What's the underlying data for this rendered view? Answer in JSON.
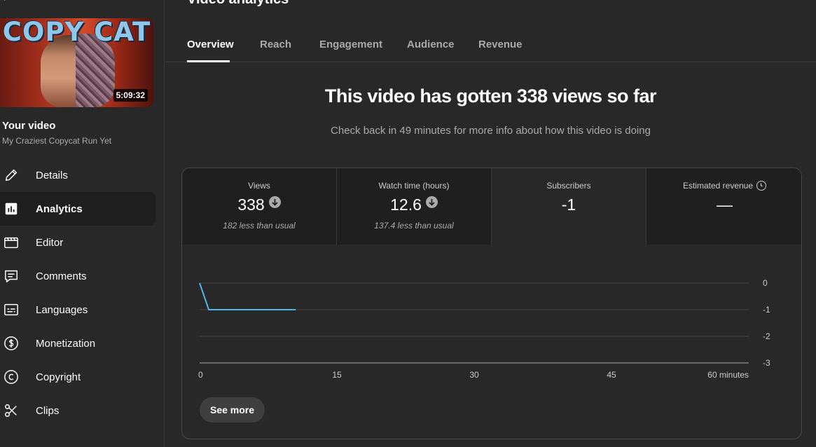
{
  "thumbnail": {
    "title_art": "COPY CAT",
    "duration": "5:09:32"
  },
  "sidebar": {
    "your_video_label": "Your video",
    "video_title": "My Craziest Copycat Run Yet",
    "items": [
      {
        "label": "Details",
        "icon": "pencil-icon"
      },
      {
        "label": "Analytics",
        "icon": "analytics-icon",
        "active": true
      },
      {
        "label": "Editor",
        "icon": "clapperboard-icon"
      },
      {
        "label": "Comments",
        "icon": "comment-icon"
      },
      {
        "label": "Languages",
        "icon": "subtitles-icon"
      },
      {
        "label": "Monetization",
        "icon": "dollar-icon"
      },
      {
        "label": "Copyright",
        "icon": "copyright-icon"
      },
      {
        "label": "Clips",
        "icon": "scissors-icon"
      }
    ]
  },
  "main": {
    "page_title": "Video analytics",
    "tabs": [
      {
        "label": "Overview",
        "active": true
      },
      {
        "label": "Reach"
      },
      {
        "label": "Engagement"
      },
      {
        "label": "Audience"
      },
      {
        "label": "Revenue"
      }
    ],
    "headline": "This video has gotten 338 views so far",
    "subline": "Check back in 49 minutes for more info about how this video is doing",
    "metrics": [
      {
        "label": "Views",
        "value": "338",
        "note": "182 less than usual",
        "trend": "down"
      },
      {
        "label": "Watch time (hours)",
        "value": "12.6",
        "note": "137.4 less than usual",
        "trend": "down"
      },
      {
        "label": "Subscribers",
        "value": "-1",
        "selected": true
      },
      {
        "label": "Estimated revenue",
        "value": "—",
        "icon": "clock-icon"
      }
    ],
    "see_more_label": "See more"
  },
  "chart_data": {
    "type": "line",
    "x": [
      0,
      1,
      10.5
    ],
    "series": [
      {
        "values": [
          0,
          -1,
          -1
        ]
      }
    ],
    "x_ticks": [
      "0",
      "15",
      "30",
      "45",
      "60 minutes"
    ],
    "y_ticks": [
      "0",
      "-1",
      "-2",
      "-3"
    ],
    "xlim": [
      0,
      60
    ],
    "ylim": [
      -3,
      0
    ],
    "line_color": "#4fb5e5",
    "grid": true
  }
}
